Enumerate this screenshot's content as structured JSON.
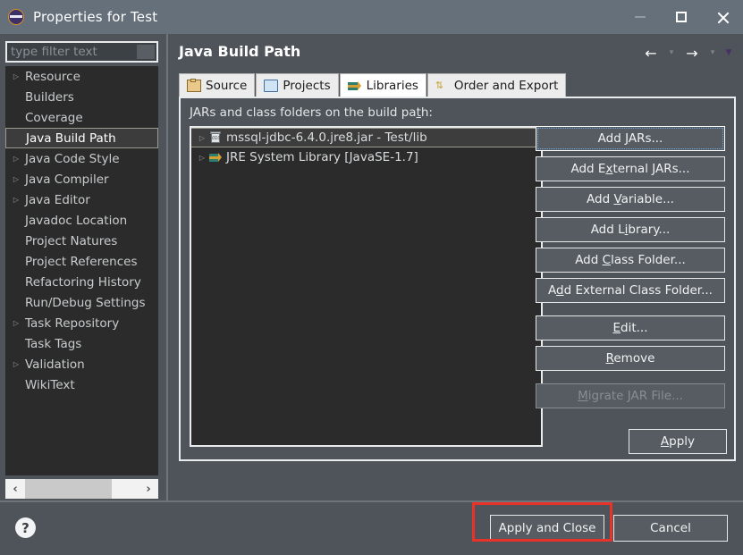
{
  "window": {
    "title": "Properties for Test",
    "app_icon": "eclipse-icon",
    "controls": {
      "minimize": "–",
      "maximize": "□",
      "close": "✕"
    }
  },
  "sidebar": {
    "filter": {
      "placeholder": "type filter text",
      "value": ""
    },
    "items": [
      {
        "label": "Resource",
        "expandable": true,
        "selected": false
      },
      {
        "label": "Builders",
        "expandable": false,
        "selected": false
      },
      {
        "label": "Coverage",
        "expandable": false,
        "selected": false
      },
      {
        "label": "Java Build Path",
        "expandable": false,
        "selected": true
      },
      {
        "label": "Java Code Style",
        "expandable": true,
        "selected": false
      },
      {
        "label": "Java Compiler",
        "expandable": true,
        "selected": false
      },
      {
        "label": "Java Editor",
        "expandable": true,
        "selected": false
      },
      {
        "label": "Javadoc Location",
        "expandable": false,
        "selected": false
      },
      {
        "label": "Project Natures",
        "expandable": false,
        "selected": false
      },
      {
        "label": "Project References",
        "expandable": false,
        "selected": false
      },
      {
        "label": "Refactoring History",
        "expandable": false,
        "selected": false
      },
      {
        "label": "Run/Debug Settings",
        "expandable": false,
        "selected": false
      },
      {
        "label": "Task Repository",
        "expandable": true,
        "selected": false
      },
      {
        "label": "Task Tags",
        "expandable": false,
        "selected": false
      },
      {
        "label": "Validation",
        "expandable": true,
        "selected": false
      },
      {
        "label": "WikiText",
        "expandable": false,
        "selected": false
      }
    ],
    "scroll_left": "‹",
    "scroll_right": "›"
  },
  "pane": {
    "title": "Java Build Path",
    "nav": {
      "back": "←",
      "back_menu": "▾",
      "forward": "→",
      "forward_menu": "▾",
      "view_menu": "▼"
    },
    "tabs": [
      {
        "label": "Source",
        "icon": "package-icon",
        "active": false
      },
      {
        "label": "Projects",
        "icon": "folder-icon",
        "active": false
      },
      {
        "label": "Libraries",
        "icon": "books-icon",
        "active": true
      },
      {
        "label": "Order and Export",
        "icon": "arrows-icon",
        "active": false
      }
    ],
    "content_label": "JARs and class folders on the build path:",
    "content_label_mnemonic": "t",
    "entries": [
      {
        "label": "mssql-jdbc-6.4.0.jre8.jar - Test/lib",
        "icon": "jar-icon",
        "selected": true
      },
      {
        "label": "JRE System Library [JavaSE-1.7]",
        "icon": "jre-icon",
        "selected": false
      }
    ],
    "buttons": [
      {
        "label": "Add JARs...",
        "mnemonic": "J",
        "state": "focused"
      },
      {
        "label": "Add External JARs...",
        "mnemonic": "x",
        "state": "normal"
      },
      {
        "label": "Add Variable...",
        "mnemonic": "V",
        "state": "normal"
      },
      {
        "label": "Add Library...",
        "mnemonic": "i",
        "state": "normal"
      },
      {
        "label": "Add Class Folder...",
        "mnemonic": "C",
        "state": "normal"
      },
      {
        "label": "Add External Class Folder...",
        "mnemonic": "d",
        "state": "normal"
      },
      {
        "label": "Edit...",
        "mnemonic": "E",
        "state": "normal",
        "group_gap": true
      },
      {
        "label": "Remove",
        "mnemonic": "R",
        "state": "normal"
      },
      {
        "label": "Migrate JAR File...",
        "mnemonic": "M",
        "state": "disabled",
        "group_gap": true
      }
    ],
    "apply_label": "Apply",
    "apply_mnemonic": "A"
  },
  "footer": {
    "help_icon": "?",
    "apply_and_close": "Apply and Close",
    "cancel": "Cancel",
    "highlight_color": "#e8332a",
    "highlight_target": "apply-and-close-button"
  }
}
